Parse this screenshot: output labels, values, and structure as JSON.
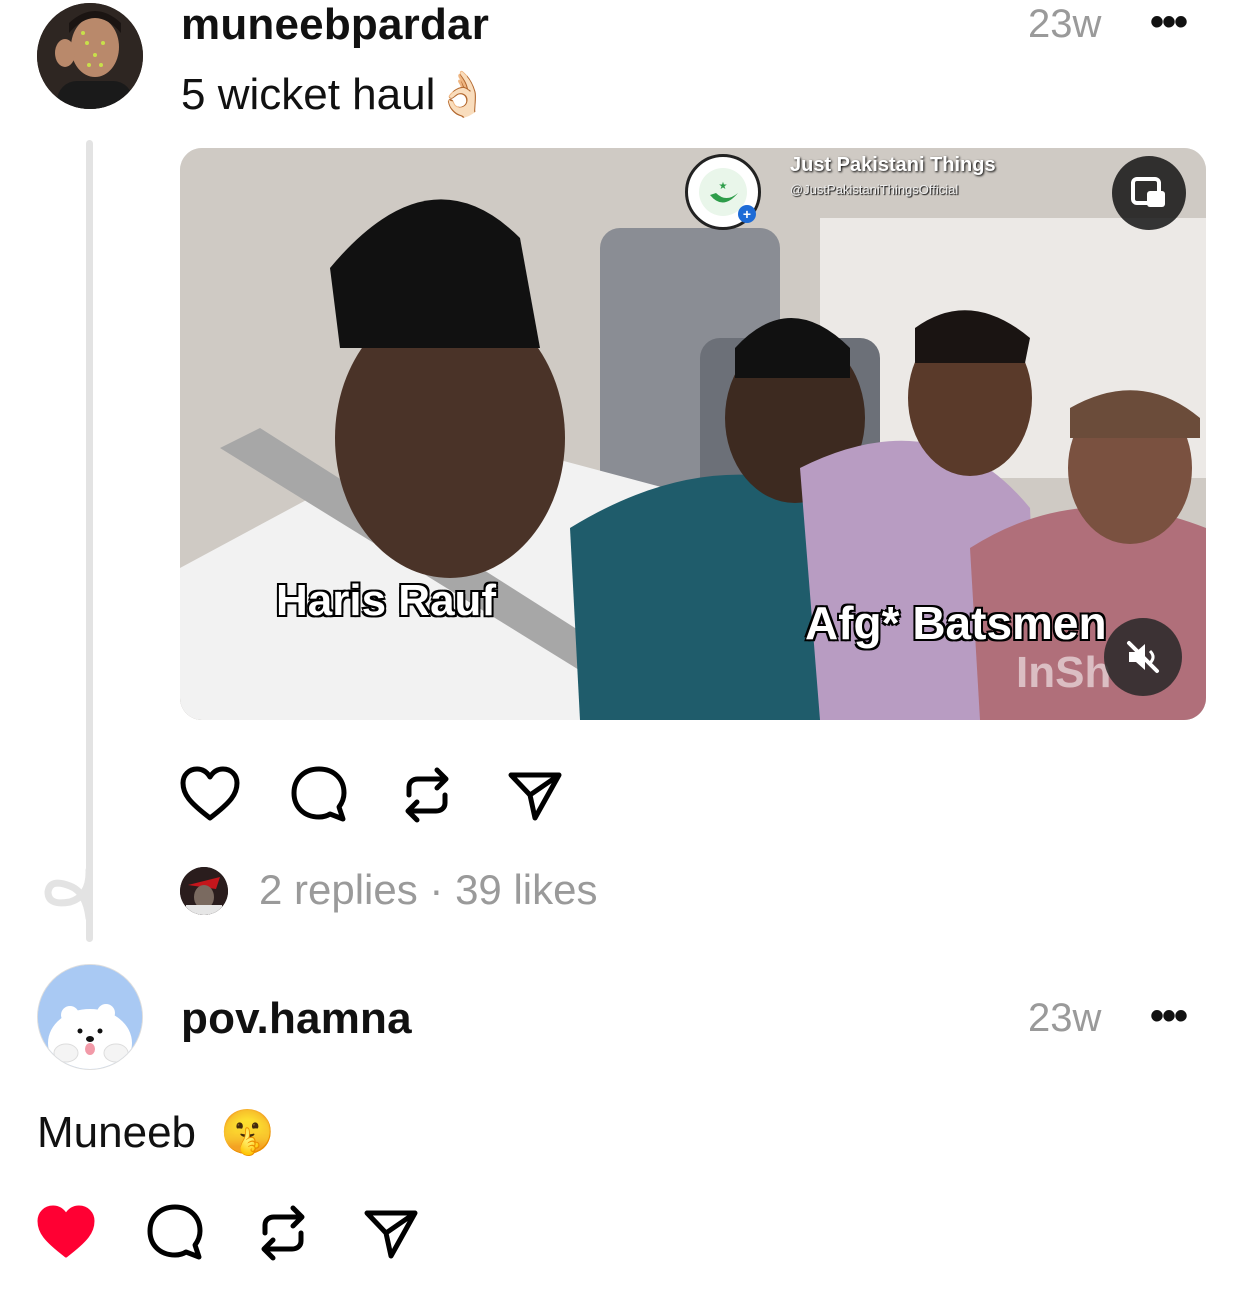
{
  "post": {
    "username": "muneebpardar",
    "time": "23w",
    "more_label": "•••",
    "caption": "5 wicket haul",
    "caption_emoji": "👌🏻",
    "video": {
      "watermark_name": "Just Pakistani Things",
      "watermark_handle": "@JustPakistaniThingsOfficial",
      "label_left": "Haris Rauf",
      "label_right": "Afg* Batsmen",
      "corner_watermark": "InSh",
      "pip_icon": "picture-in-picture-icon",
      "mute_icon": "muted-speaker-icon"
    },
    "actions": [
      "heart-icon",
      "comment-icon",
      "repost-icon",
      "share-icon"
    ],
    "meta_text": "2 replies · 39 likes"
  },
  "reply": {
    "username": "pov.hamna",
    "time": "23w",
    "more_label": "•••",
    "text": "Muneeb",
    "emoji": "🤫",
    "liked": true,
    "like_color": "#ff0033"
  }
}
